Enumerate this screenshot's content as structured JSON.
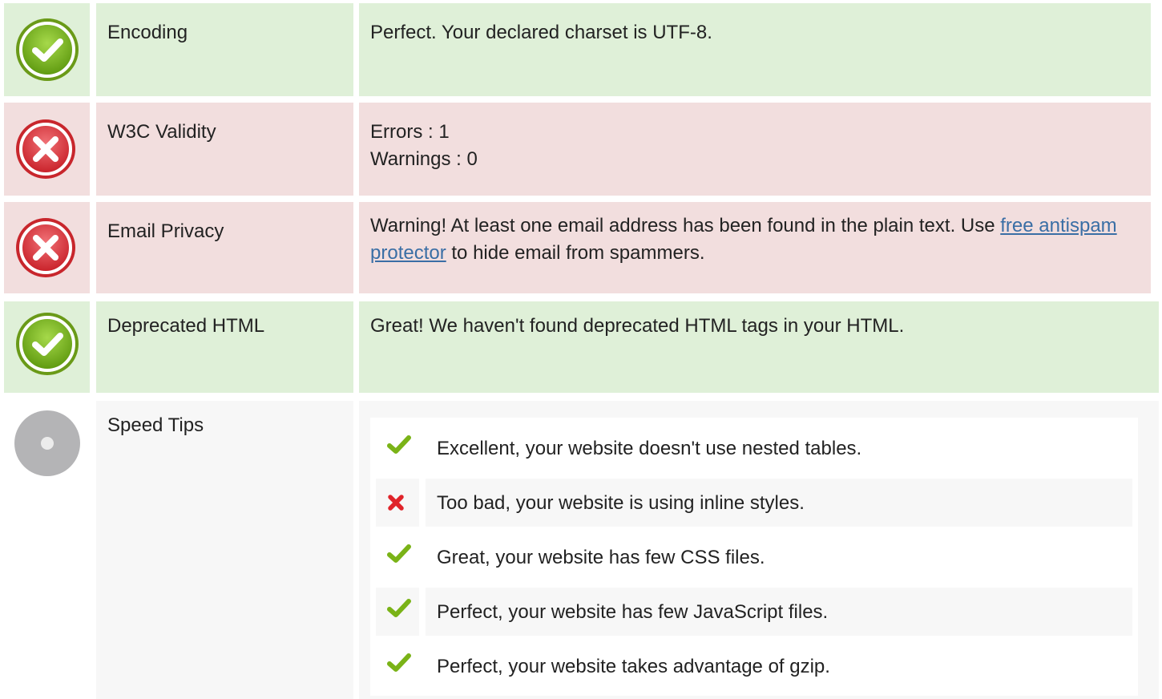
{
  "rows": [
    {
      "status": "pass",
      "label": "Encoding",
      "text": "Perfect. Your declared charset is UTF-8."
    },
    {
      "status": "fail",
      "label": "W3C Validity",
      "lines": [
        "Errors : 1",
        "Warnings : 0"
      ]
    },
    {
      "status": "fail",
      "label": "Email Privacy",
      "text_before": "Warning! At least one email address has been found in the plain text. Use ",
      "link": "free antispam protector",
      "text_after": " to hide email from spammers."
    },
    {
      "status": "pass",
      "label": "Deprecated HTML",
      "text": "Great! We haven't found deprecated HTML tags in your HTML."
    },
    {
      "status": "neutral",
      "label": "Speed Tips"
    }
  ],
  "speed_tips": [
    {
      "status": "pass",
      "icon": "check-icon",
      "text": "Excellent, your website doesn't use nested tables."
    },
    {
      "status": "fail",
      "icon": "cross-icon",
      "text": "Too bad, your website is using inline styles."
    },
    {
      "status": "pass",
      "icon": "check-icon",
      "text": "Great, your website has few CSS files."
    },
    {
      "status": "pass",
      "icon": "check-icon",
      "text": "Perfect, your website has few JavaScript files."
    },
    {
      "status": "pass",
      "icon": "check-icon",
      "text": "Perfect, your website takes advantage of gzip."
    }
  ],
  "colors": {
    "pass_bg": "#dff0d8",
    "fail_bg": "#f2dede",
    "neutral_bg": "#f7f7f7",
    "pass_icon": "#7ab317",
    "fail_icon": "#e0353b",
    "neutral_icon": "#b0b0b2",
    "link": "#3a6ea5"
  }
}
